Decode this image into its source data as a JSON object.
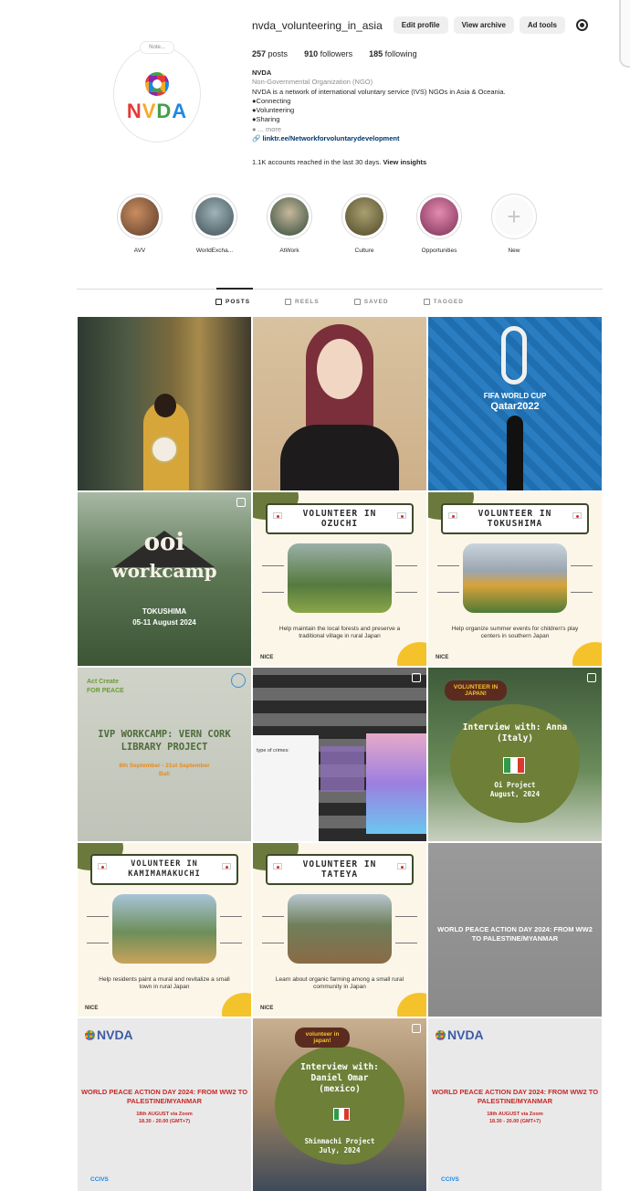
{
  "profile": {
    "username": "nvda_volunteering_in_asia",
    "buttons": {
      "edit": "Edit profile",
      "archive": "View archive",
      "ad_tools": "Ad tools"
    },
    "avatar_note": "Note...",
    "logo_text": {
      "n": "N",
      "v": "V",
      "d": "D",
      "a": "A"
    },
    "stats": {
      "posts_count": "257",
      "posts_label": "posts",
      "followers_count": "910",
      "followers_label": "followers",
      "following_count": "185",
      "following_label": "following"
    },
    "bio": {
      "name": "NVDA",
      "category": "Non-Governmental Organization (NGO)",
      "line1": "NVDA is a network of international voluntary service (IVS) NGOs in Asia & Oceania.",
      "bullets": [
        "●Connecting",
        "●Volunteering",
        "●Sharing",
        "● ... more"
      ],
      "link": "linktr.ee/Networkforvoluntarydevelopment"
    },
    "reach_text": "1.1K accounts reached in the last 30 days.",
    "reach_link": "View insights"
  },
  "highlights": [
    {
      "label": "AVV",
      "color": "#8a6a52"
    },
    {
      "label": "WorldExcha...",
      "color": "#6c7f86"
    },
    {
      "label": "AtWork",
      "color": "#4f6e5a"
    },
    {
      "label": "Culture",
      "color": "#7a6a3a"
    },
    {
      "label": "Opportunities",
      "color": "#b5547a"
    },
    {
      "label": "New",
      "color": "#fafafa"
    }
  ],
  "tabs": [
    {
      "label": "POSTS",
      "active": true
    },
    {
      "label": "REELS",
      "active": false
    },
    {
      "label": "SAVED",
      "active": false
    },
    {
      "label": "TAGGED",
      "active": false
    }
  ],
  "posts": {
    "fifa_line1": "FIFA WORLD CUP",
    "fifa_line2": "Qatar2022",
    "workcamp_big1": "ooi",
    "workcamp_big2": "workcamp",
    "workcamp_sub1": "TOKUSHIMA",
    "workcamp_sub2": "05-11 August 2024",
    "ozuchi_title": "VOLUNTEER IN OZUCHI",
    "ozuchi_caption": "Help maintain the local forests and preserve a traditional village in rural Japan",
    "tokushima_title": "VOLUNTEER IN TOKUSHIMA",
    "tokushima_caption": "Help organize summer events for children's play centers in southern Japan",
    "kamimamakuchi_title": "VOLUNTEER IN KAMIMAMAKUCHI",
    "kamimamakuchi_caption": "Help residents paint a mural and revitalize a small town in rural Japan",
    "tateya_title": "VOLUNTEER IN TATEYA",
    "tateya_caption": "Learn about organic farming among a small rural community in Japan",
    "nice_label": "NICE",
    "ivp_logo1": "Act Create",
    "ivp_logo2": "FOR PEACE",
    "ivp_title": "IVP WORKCAMP: VERN CORK LIBRARY PROJECT",
    "ivp_date": "8th September - 21st September",
    "ivp_place": "Bali",
    "collage_text": "type of crimes:",
    "anna_tag": "VOLUNTEER IN JAPAN!",
    "anna_title": "Interview with: Anna (Italy)",
    "anna_project": "Oi Project",
    "anna_date": "August, 2024",
    "peace_gray_title": "WORLD PEACE ACTION DAY 2024: FROM WW2 TO PALESTINE/MYANMAR",
    "peace_logo": "NVDA",
    "peace_title": "WORLD PEACE ACTION DAY 2024: FROM WW2 TO PALESTINE/MYANMAR",
    "peace_date1": "18th AUGUST via Zoom",
    "peace_date2": "18.30 - 20.00 (GMT+7)",
    "peace_bottom": "CCIVS",
    "daniel_tag": "volunteer in japan!",
    "daniel_title": "Interview with: Daniel Omar (mexico)",
    "daniel_project": "Shinmachi Project",
    "daniel_date": "July, 2024"
  }
}
